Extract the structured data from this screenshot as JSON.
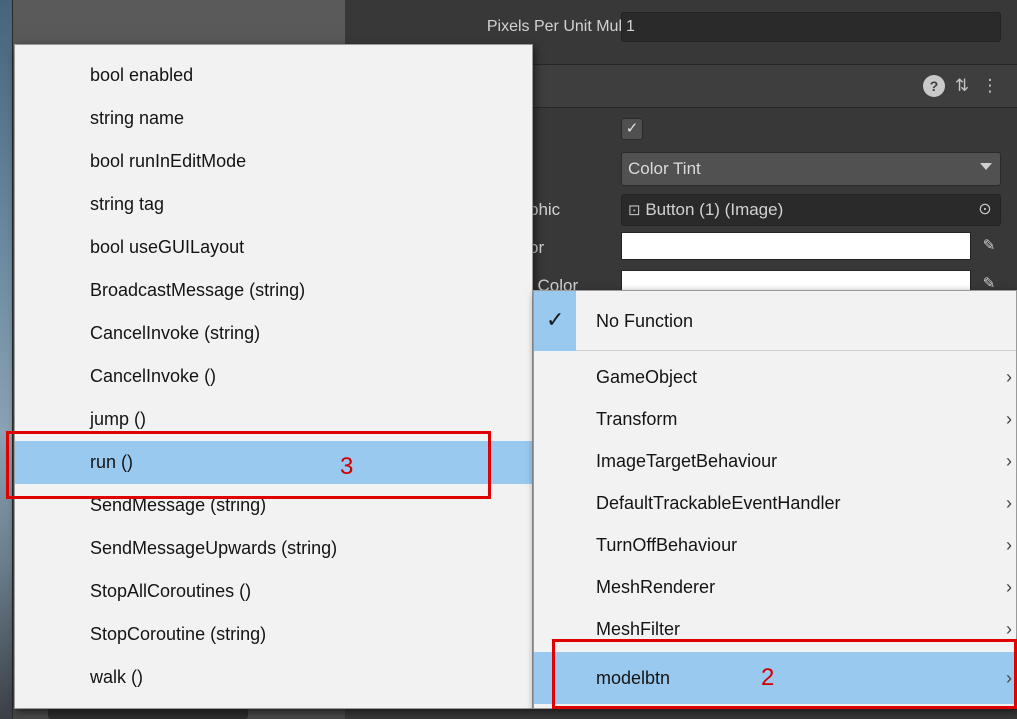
{
  "inspector": {
    "ppu_label": "Pixels Per Unit Mul",
    "ppu_value": "1",
    "component_title_fragment": "n",
    "transition_value": "Color Tint",
    "target_graphic_label_fragment": "phic",
    "target_graphic_value": "Button (1) (Image)",
    "normal_color_label_fragment": "or",
    "highlighted_color_label_fragment": "l Color"
  },
  "left_menu": {
    "items": [
      "bool enabled",
      "string name",
      "bool runInEditMode",
      "string tag",
      "bool useGUILayout",
      "BroadcastMessage (string)",
      "CancelInvoke (string)",
      "CancelInvoke ()",
      "jump ()",
      "run ()",
      "SendMessage (string)",
      "SendMessageUpwards (string)",
      "StopAllCoroutines ()",
      "StopCoroutine (string)",
      "walk ()"
    ],
    "selected_index": 9
  },
  "right_menu": {
    "no_function": "No Function",
    "items": [
      "GameObject",
      "Transform",
      "ImageTargetBehaviour",
      "DefaultTrackableEventHandler",
      "TurnOffBehaviour",
      "MeshRenderer",
      "MeshFilter",
      "modelbtn"
    ],
    "selected_index": 7,
    "chevron": "›"
  },
  "annotations": {
    "step2": "2",
    "step3": "3",
    "color": "#e00000"
  },
  "icons": {
    "check": "✓",
    "help": "?",
    "settings": "⇅",
    "more": "⋮",
    "image": "⊡",
    "picker": "⊙",
    "eyedropper": "✎"
  },
  "colors": {
    "menu_bg": "#f2f2f2",
    "selection": "#99c9ef",
    "inspector_bg": "#383838"
  }
}
